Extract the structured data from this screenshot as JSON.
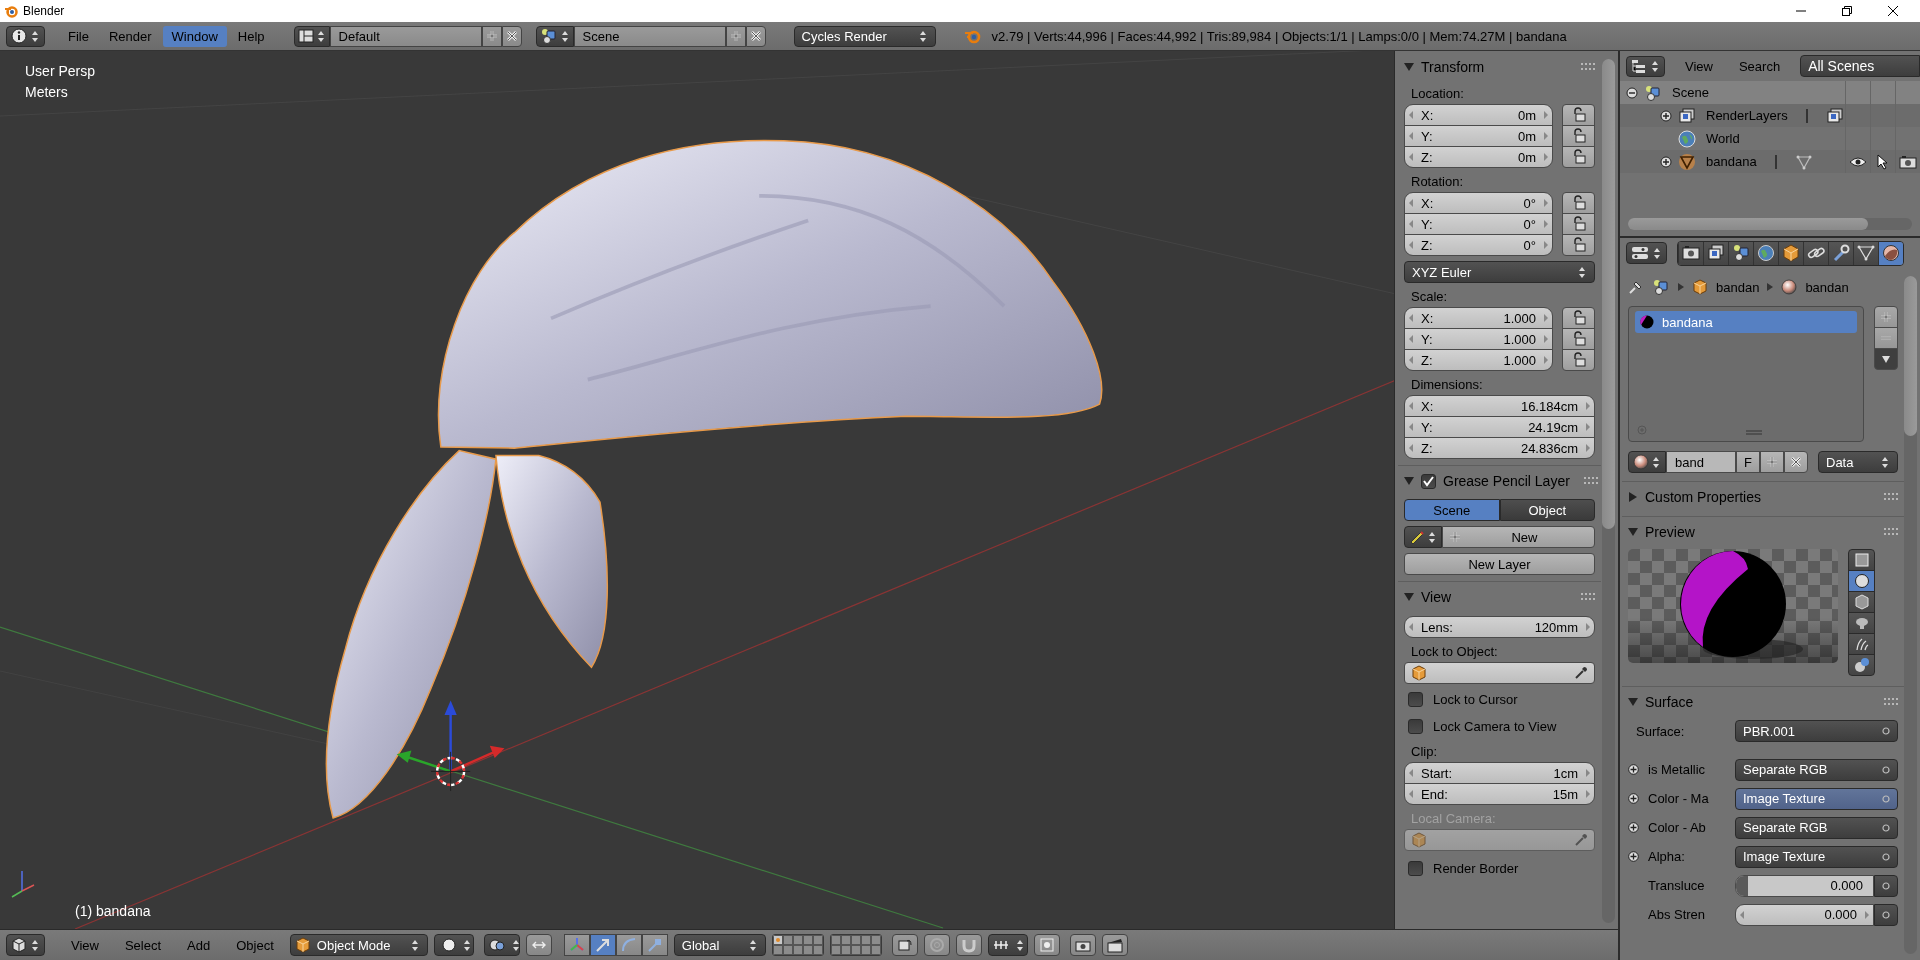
{
  "window": {
    "title": "Blender"
  },
  "info_header": {
    "menu": [
      {
        "label": "File",
        "selected": false
      },
      {
        "label": "Render",
        "selected": false
      },
      {
        "label": "Window",
        "selected": true
      },
      {
        "label": "Help",
        "selected": false
      }
    ],
    "screen_layout": "Default",
    "scene": "Scene",
    "render_engine": "Cycles Render",
    "stats": "v2.79 | Verts:44,996 | Faces:44,992 | Tris:89,984 | Objects:1/1 | Lamps:0/0 | Mem:74.27M | bandana"
  },
  "viewport": {
    "view_name": "User Persp",
    "units": "Meters",
    "active_object": "(1) bandana"
  },
  "transform": {
    "title": "Transform",
    "expanded": true,
    "location": {
      "label": "Location:",
      "fields": [
        {
          "axis": "X:",
          "value": "0m"
        },
        {
          "axis": "Y:",
          "value": "0m"
        },
        {
          "axis": "Z:",
          "value": "0m"
        }
      ]
    },
    "rotation": {
      "label": "Rotation:",
      "fields": [
        {
          "axis": "X:",
          "value": "0°"
        },
        {
          "axis": "Y:",
          "value": "0°"
        },
        {
          "axis": "Z:",
          "value": "0°"
        }
      ]
    },
    "rotation_mode": "XYZ Euler",
    "scale": {
      "label": "Scale:",
      "fields": [
        {
          "axis": "X:",
          "value": "1.000"
        },
        {
          "axis": "Y:",
          "value": "1.000"
        },
        {
          "axis": "Z:",
          "value": "1.000"
        }
      ]
    },
    "dimensions": {
      "label": "Dimensions:",
      "fields": [
        {
          "axis": "X:",
          "value": "16.184cm"
        },
        {
          "axis": "Y:",
          "value": "24.19cm"
        },
        {
          "axis": "Z:",
          "value": "24.836cm"
        }
      ]
    }
  },
  "grease_pencil": {
    "title": "Grease Pencil Layer",
    "expanded": true,
    "enabled": true,
    "source_tabs": [
      {
        "label": "Scene",
        "selected": true
      },
      {
        "label": "Object",
        "selected": false
      }
    ],
    "new_button": "New",
    "new_layer_button": "New Layer"
  },
  "view_panel": {
    "title": "View",
    "expanded": true,
    "lens": {
      "label": "Lens:",
      "value": "120mm"
    },
    "lock_to_object_label": "Lock to Object:",
    "lock_options": [
      {
        "label": "Lock to Cursor",
        "checked": false
      },
      {
        "label": "Lock Camera to View",
        "checked": false
      }
    ],
    "clip_label": "Clip:",
    "clip": [
      {
        "label": "Start:",
        "value": "1cm"
      },
      {
        "label": "End:",
        "value": "15m"
      }
    ],
    "local_camera": {
      "label": "Local Camera:",
      "disabled": true
    },
    "render_border": {
      "label": "Render Border",
      "checked": false
    }
  },
  "outliner": {
    "menu": [
      "View",
      "Search"
    ],
    "display_mode": "All Scenes",
    "tree": [
      {
        "kind": "scene",
        "label": "Scene",
        "selected": true,
        "expanded": true,
        "children": [
          {
            "kind": "render_layers",
            "label": "RenderLayers",
            "selected": false,
            "expanded": false
          },
          {
            "kind": "world",
            "label": "World",
            "selected": false
          },
          {
            "kind": "object",
            "label": "bandana",
            "selected": false,
            "expanded": false
          }
        ]
      }
    ]
  },
  "properties": {
    "tabs": [
      {
        "selected": false
      },
      {
        "selected": false
      },
      {
        "selected": false
      },
      {
        "selected": false
      },
      {
        "selected": false
      },
      {
        "selected": false
      },
      {
        "selected": false
      },
      {
        "selected": false
      },
      {
        "selected": true
      }
    ],
    "breadcrumb": [
      "bandan",
      "bandan"
    ],
    "material_slots": [
      {
        "name": "bandana",
        "selected": true
      }
    ],
    "material": {
      "name": "band",
      "fake_user": "F",
      "link": "Data"
    },
    "custom_properties": {
      "title": "Custom Properties",
      "expanded": false
    },
    "preview": {
      "title": "Preview",
      "expanded": true,
      "shapes": [
        {
          "selected": false
        },
        {
          "selected": true
        },
        {
          "selected": false
        },
        {
          "selected": false
        },
        {
          "selected": false
        },
        {
          "selected": false
        }
      ]
    },
    "surface": {
      "title": "Surface",
      "expanded": true,
      "label": "Surface:",
      "shader": "PBR.001",
      "inputs": [
        {
          "kind": "link",
          "label": "is Metallic",
          "value": "Separate RGB",
          "highlighted": false
        },
        {
          "kind": "link",
          "label": "Color - Ma",
          "value": "Image Texture",
          "highlighted": true
        },
        {
          "kind": "link",
          "label": "Color - Ab",
          "value": "Separate RGB",
          "highlighted": false
        },
        {
          "kind": "link",
          "label": "Alpha:",
          "value": "Image Texture",
          "highlighted": false
        },
        {
          "kind": "slider",
          "label": "Transluce",
          "value": "0.000",
          "level": 0
        },
        {
          "kind": "number",
          "label": "Abs Stren",
          "value": "0.000"
        }
      ]
    }
  },
  "view3d_header": {
    "menu": [
      "View",
      "Select",
      "Add",
      "Object"
    ],
    "mode": "Object Mode",
    "manipulators": [
      {
        "selected": false
      },
      {
        "selected": true
      },
      {
        "selected": false
      },
      {
        "selected": false
      }
    ],
    "orientation": "Global",
    "layers": [
      {
        "active": true
      },
      {
        "active": false
      },
      {
        "active": false
      },
      {
        "active": false
      },
      {
        "active": false
      },
      {
        "active": false
      },
      {
        "active": false
      },
      {
        "active": false
      },
      {
        "active": false
      },
      {
        "active": false
      },
      {
        "active": false
      },
      {
        "active": false
      },
      {
        "active": false
      },
      {
        "active": false
      },
      {
        "active": false
      },
      {
        "active": false
      },
      {
        "active": false
      },
      {
        "active": false
      },
      {
        "active": false
      },
      {
        "active": false
      }
    ]
  }
}
